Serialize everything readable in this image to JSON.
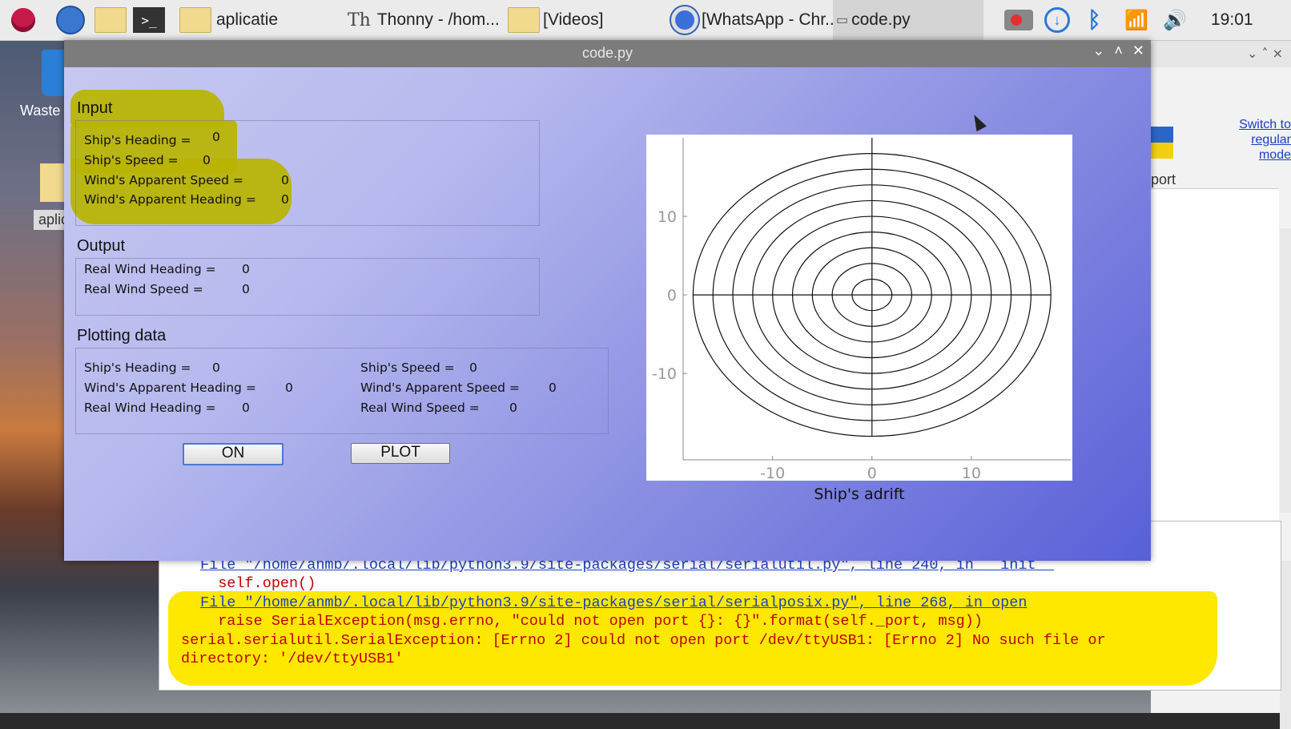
{
  "taskbar": {
    "items": [
      {
        "name": "raspberry-menu",
        "label": ""
      },
      {
        "name": "browser",
        "label": ""
      },
      {
        "name": "file-manager",
        "label": ""
      },
      {
        "name": "terminal",
        "label": ">_"
      },
      {
        "name": "folder-aplicatie",
        "label": "aplicatie"
      },
      {
        "name": "thonny",
        "label": "Thonny  -  /hom..."
      },
      {
        "name": "folder-videos",
        "label": "[Videos]"
      },
      {
        "name": "chrome-whatsapp",
        "label": "[WhatsApp - Chr..."
      },
      {
        "name": "code-py",
        "label": "code.py"
      }
    ],
    "clock": "19:01"
  },
  "desktop": {
    "trash_label": "Waste",
    "folder_label": "aplic"
  },
  "background_window": {
    "switch_link": "Switch to regular mode",
    "port_text": "port"
  },
  "shell": {
    "line1_link": "File \"/home/anmb/.local/lib/python3.9/site-packages/serial/serialutil.py\", line 240, in __init__",
    "line2": "  self.open()",
    "line3_link": "File \"/home/anmb/.local/lib/python3.9/site-packages/serial/serialposix.py\", line 268, in open",
    "line4": "  raise SerialException(msg.errno, \"could not open port {}: {}\".format(self._port, msg))",
    "line5": "serial.serialutil.SerialException: [Errno 2] could not open port /dev/ttyUSB1: [Errno 2] No such file or",
    "line6": "directory: '/dev/ttyUSB1'"
  },
  "main_window": {
    "title": "code.py",
    "input": {
      "title": "Input",
      "ship_heading_label": "Ship's Heading =",
      "ship_heading_value": "0",
      "ship_speed_label": "Ship's Speed =",
      "ship_speed_value": "0",
      "wind_apparent_speed_label": "Wind's Apparent Speed =",
      "wind_apparent_speed_value": "0",
      "wind_apparent_heading_label": "Wind's Apparent Heading =",
      "wind_apparent_heading_value": "0"
    },
    "output": {
      "title": "Output",
      "real_wind_heading_label": "Real Wind Heading =",
      "real_wind_heading_value": "0",
      "real_wind_speed_label": "Real Wind Speed =",
      "real_wind_speed_value": "0"
    },
    "plotting": {
      "title": "Plotting data",
      "ship_heading_label": "Ship's Heading =",
      "ship_heading_value": "0",
      "ship_speed_label": "Ship's Speed =",
      "ship_speed_value": "0",
      "wind_apparent_heading_label": "Wind's Apparent Heading =",
      "wind_apparent_heading_value": "0",
      "wind_apparent_speed_label": "Wind's Apparent Speed =",
      "wind_apparent_speed_value": "0",
      "real_wind_heading_label": "Real Wind Heading =",
      "real_wind_heading_value": "0",
      "real_wind_speed_label": "Real Wind Speed =",
      "real_wind_speed_value": "0"
    },
    "buttons": {
      "on_label": "ON",
      "plot_label": "PLOT"
    }
  },
  "chart_data": {
    "type": "polar-rings",
    "title": "",
    "xlabel": "Ship's adrift",
    "ylabel": "",
    "xlim": [
      -19,
      20
    ],
    "ylim": [
      -21,
      20
    ],
    "xticks": [
      -10,
      0,
      10
    ],
    "yticks": [
      -10,
      0,
      10
    ],
    "ring_radii": [
      2,
      4,
      6,
      8,
      10,
      12,
      14,
      16,
      18
    ],
    "axis_lines": true,
    "grid": false
  }
}
